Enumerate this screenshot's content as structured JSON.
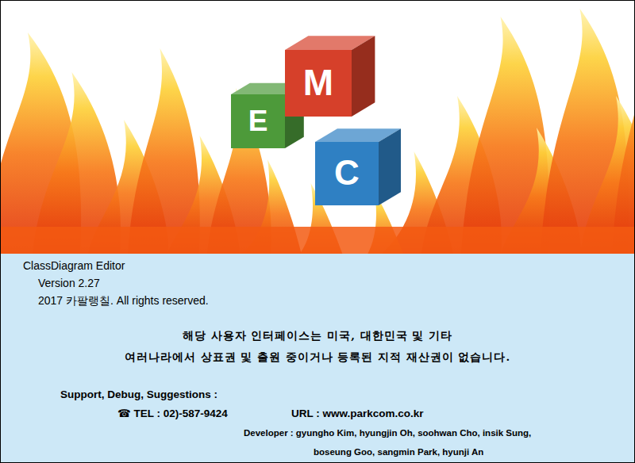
{
  "splash": {
    "logo_letters": [
      {
        "letter": "M",
        "color": "#d6402a"
      },
      {
        "letter": "E",
        "color": "#4d9a3a"
      },
      {
        "letter": "C",
        "color": "#2f80c3"
      }
    ]
  },
  "product": {
    "name": "ClassDiagram Editor",
    "version": "Version 2.27",
    "copyright": "2017 카팔랭칠. All rights reserved."
  },
  "notice": [
    "해당 사용자 인터페이스는 미국, 대한민국 및 기타",
    "여러나라에서 상표권 및 출원 중이거나 등록된 지적 재산권이 없습니다."
  ],
  "support": {
    "heading": "Support, Debug, Suggestions :",
    "tel": "☎ TEL : 02)-587-9424",
    "url": "URL : www.parkcom.co.kr",
    "developer_lines": [
      "Developer : gyungho Kim, hyungjin Oh, soohwan Cho, insik Sung,",
      "boseung Goo, sangmin Park, hyunji An"
    ]
  }
}
